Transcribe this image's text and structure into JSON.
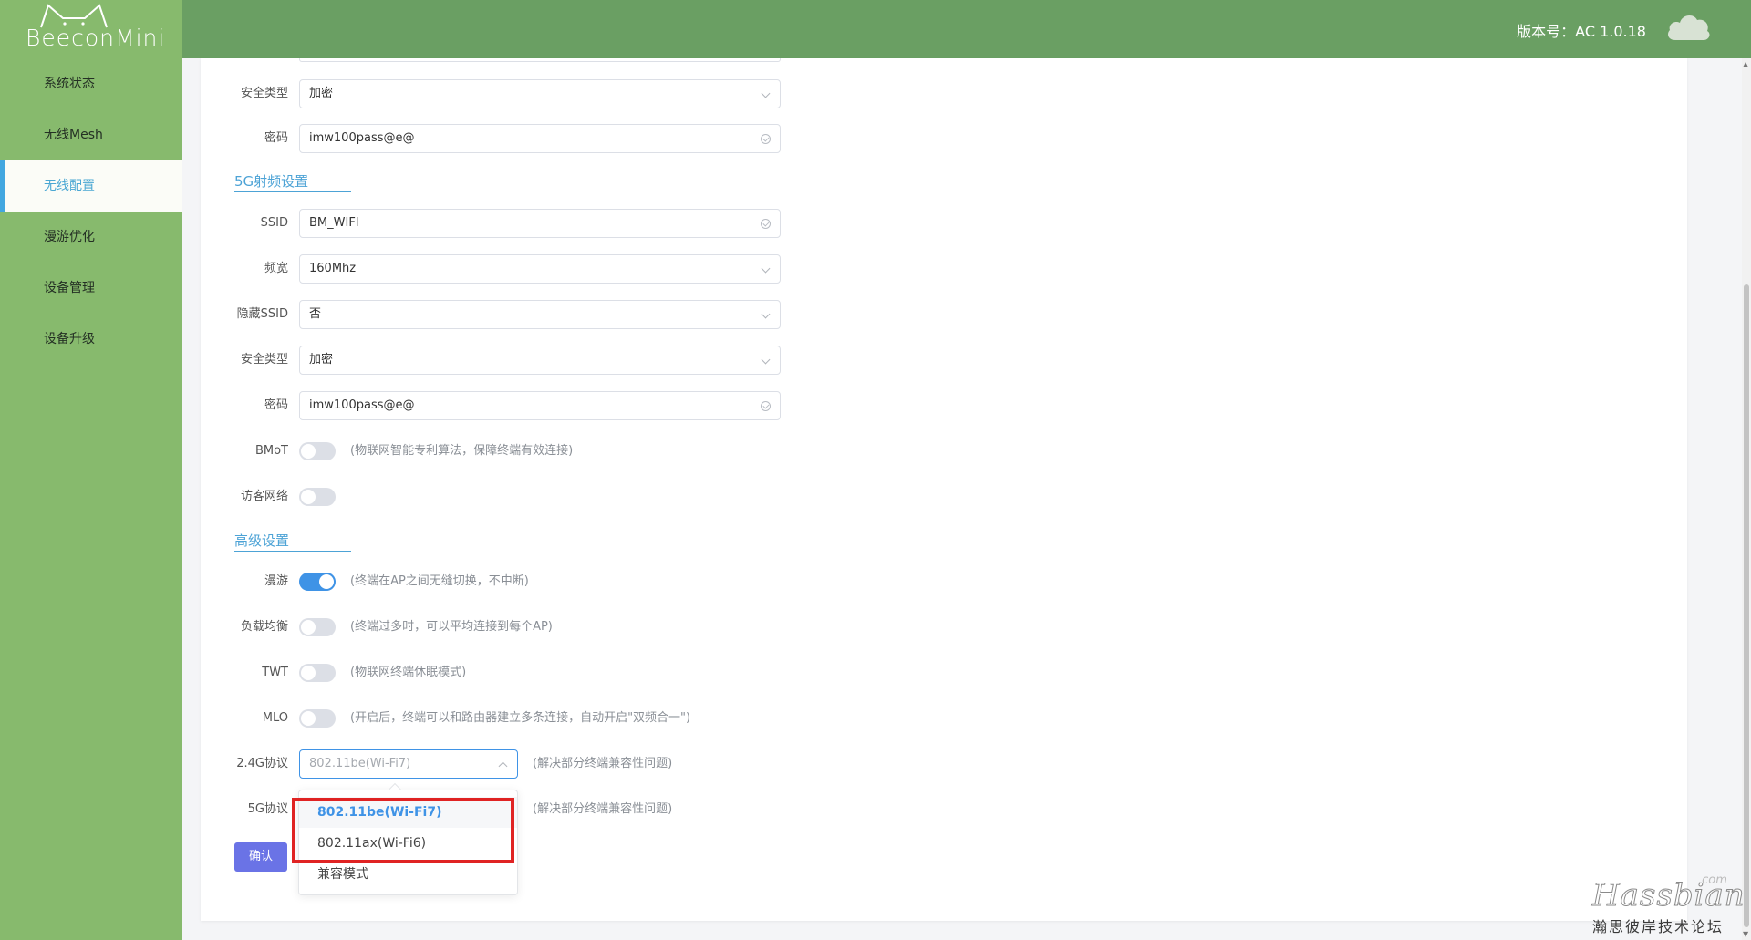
{
  "app": {
    "logo_text": "BeeconMini",
    "version_text": "版本号：AC 1.0.18"
  },
  "sidebar": {
    "items": [
      {
        "label": "系统状态"
      },
      {
        "label": "无线Mesh"
      },
      {
        "label": "无线配置",
        "active": true
      },
      {
        "label": "漫游优化"
      },
      {
        "label": "设备管理"
      },
      {
        "label": "设备升级"
      }
    ]
  },
  "form_24g_tail": {
    "security_label": "安全类型",
    "security_value": "加密",
    "password_label": "密码",
    "password_value": "imw100pass@e@"
  },
  "section_5g": {
    "title": "5G射频设置",
    "ssid_label": "SSID",
    "ssid_value": "BM_WIFI",
    "bandwidth_label": "频宽",
    "bandwidth_value": "160Mhz",
    "hidden_ssid_label": "隐藏SSID",
    "hidden_ssid_value": "否",
    "security_label": "安全类型",
    "security_value": "加密",
    "password_label": "密码",
    "password_value": "imw100pass@e@",
    "bmot_label": "BMoT",
    "bmot_hint": "(物联网智能专利算法，保障终端有效连接)",
    "bmot_on": false,
    "guest_label": "访客网络",
    "guest_on": false
  },
  "advanced": {
    "title": "高级设置",
    "roaming_label": "漫游",
    "roaming_hint": "(终端在AP之间无缝切换，不中断)",
    "roaming_on": true,
    "load_balance_label": "负载均衡",
    "load_balance_hint": "(终端过多时，可以平均连接到每个AP)",
    "load_balance_on": false,
    "twt_label": "TWT",
    "twt_hint": "(物联网终端休眠模式)",
    "twt_on": false,
    "mlo_label": "MLO",
    "mlo_hint": "(开启后，终端可以和路由器建立多条连接，自动开启\"双频合一\")",
    "mlo_on": false,
    "proto24_label": "2.4G协议",
    "proto24_placeholder": "802.11be(Wi-Fi7)",
    "proto24_hint": "(解决部分终端兼容性问题)",
    "proto5_label": "5G协议",
    "proto5_hint": "(解决部分终端兼容性问题)",
    "confirm_label": "确认"
  },
  "dropdown": {
    "options": [
      {
        "label": "802.11be(Wi-Fi7)",
        "selected": true
      },
      {
        "label": "802.11ax(Wi-Fi6)"
      },
      {
        "label": "兼容模式"
      }
    ]
  },
  "watermark": {
    "main": "Hassbian",
    "com": ".com",
    "sub": "瀚思彼岸技术论坛"
  },
  "colors": {
    "sidebar": "#87ba6d",
    "header": "#6a9f63",
    "accent": "#3f93e6",
    "section": "#4da3d6",
    "highlight": "#e02323"
  }
}
